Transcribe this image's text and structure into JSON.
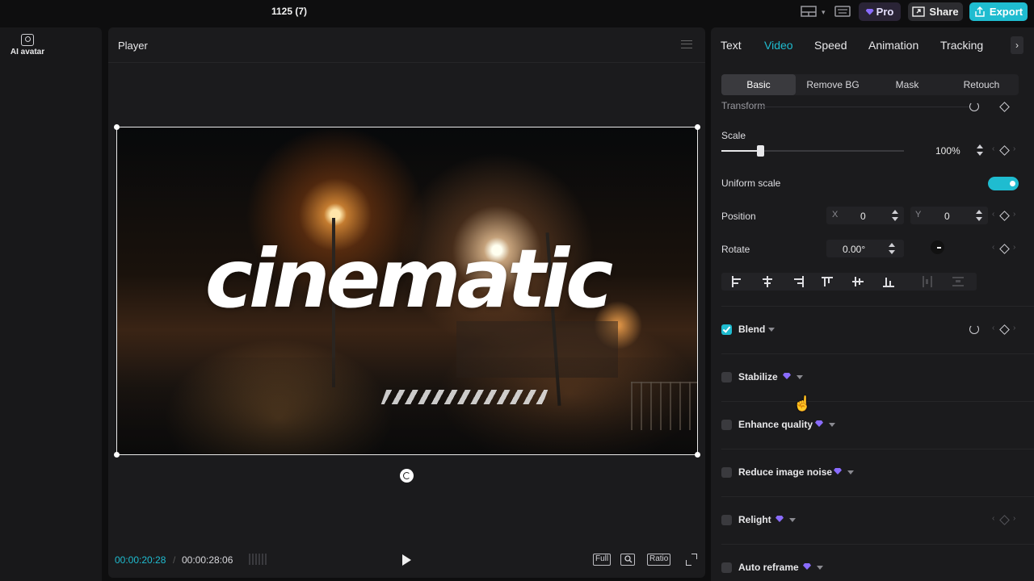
{
  "app": {
    "project_title": "1125 (7)",
    "pro_label": "Pro",
    "share_label": "Share",
    "export_label": "Export"
  },
  "leftrail": {
    "ai_avatar_label": "AI avatar"
  },
  "player": {
    "title": "Player",
    "overlay_text": "cinematic",
    "current_time": "00:00:20:28",
    "separator": "/",
    "total_time": "00:00:28:06",
    "full_label": "Full",
    "ratio_label": "Ratio"
  },
  "panel": {
    "tabs": [
      "Text",
      "Video",
      "Speed",
      "Animation",
      "Tracking"
    ],
    "active_tab": "Video",
    "subtabs": [
      "Basic",
      "Remove BG",
      "Mask",
      "Retouch"
    ],
    "active_subtab": "Basic",
    "transform_label": "Transform",
    "scale": {
      "label": "Scale",
      "value": "100%",
      "slider_fraction": 0.22
    },
    "uniform_scale": {
      "label": "Uniform scale",
      "on": true
    },
    "position": {
      "label": "Position",
      "x_label": "X",
      "x": "0",
      "y_label": "Y",
      "y": "0"
    },
    "rotate": {
      "label": "Rotate",
      "value": "0.00°"
    },
    "features": [
      {
        "label": "Blend",
        "checked": true,
        "pro": false
      },
      {
        "label": "Stabilize",
        "checked": false,
        "pro": true
      },
      {
        "label": "Enhance quality",
        "checked": false,
        "pro": true
      },
      {
        "label": "Reduce image noise",
        "checked": false,
        "pro": true
      },
      {
        "label": "Relight",
        "checked": false,
        "pro": true
      },
      {
        "label": "Auto reframe",
        "checked": false,
        "pro": true
      }
    ]
  },
  "colors": {
    "accent": "#1fbcd0",
    "pro_gem": "#8a6cff",
    "panel_bg": "#1b1b1d"
  }
}
